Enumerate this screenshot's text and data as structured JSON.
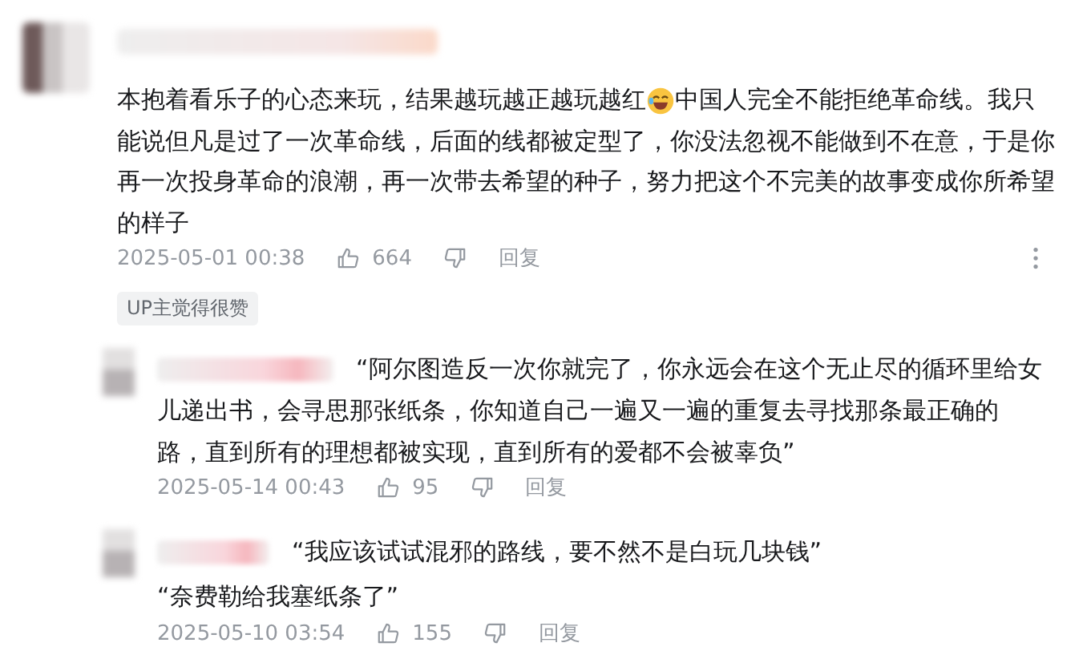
{
  "comments": [
    {
      "lines": [
        [
          {
            "kind": "text",
            "text": "本抱着看乐子的心态来玩，结果越玩越正越玩越红"
          },
          {
            "kind": "emoji"
          },
          {
            "kind": "text",
            "text": "中国人完全不能拒绝革命线。我只"
          }
        ],
        [
          {
            "kind": "text",
            "text": "能说但凡是过了一次革命线，后面的线都被定型了，你没法忽视不能做到不在意，于是你"
          }
        ],
        [
          {
            "kind": "text",
            "text": "再一次投身革命的浪潮，再一次带去希望的种子，努力把这个不完美的故事变成你所希望"
          }
        ],
        [
          {
            "kind": "text",
            "text": "的样子"
          }
        ]
      ],
      "time": "2025-05-01 00:38",
      "likes": "664",
      "reply_label": "回复",
      "badge": "UP主觉得很赞",
      "replies": [
        {
          "lines": [
            "“阿尔图造反一次你就完了，你永远会在这个无止尽的循环里给女",
            "儿递出书，会寻思那张纸条，你知道自己一遍又一遍的重复去寻找那条最正确的",
            "路，直到所有的理想都被实现，直到所有的爱都不会被辜负”"
          ],
          "time": "2025-05-14 00:43",
          "likes": "95",
          "reply_label": "回复"
        },
        {
          "lines": [
            "“我应该试试混邪的路线，要不然不是白玩几块钱”",
            "“奈费勒给我塞纸条了”"
          ],
          "time": "2025-05-10 03:54",
          "likes": "155",
          "reply_label": "回复"
        }
      ]
    }
  ]
}
